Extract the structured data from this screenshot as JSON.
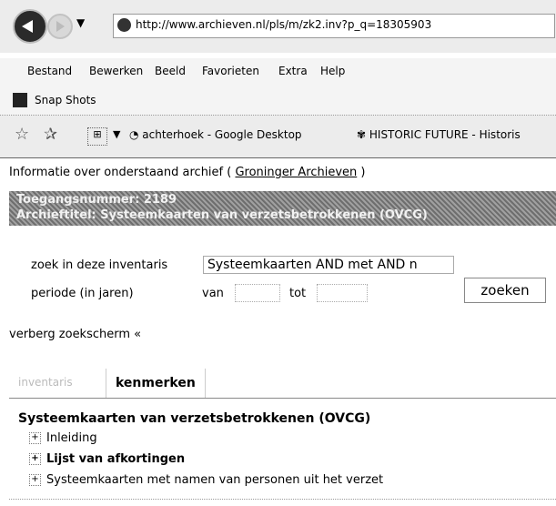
{
  "browser": {
    "url": "http://www.archieven.nl/pls/m/zk2.inv?p_q=18305903",
    "menu": [
      "Bestand",
      "Bewerken",
      "Beeld",
      "Favorieten",
      "Extra",
      "Help"
    ],
    "snapshots_label": "Snap Shots",
    "bookmarks": [
      "achterhoek - Google Desktop",
      "HISTORIC FUTURE - Historis"
    ]
  },
  "page": {
    "archive_info_prefix": "Informatie over onderstaand archief ( ",
    "archive_link": "Groninger Archieven",
    "archive_info_suffix": " )",
    "banner_line1": "Toegangsnummer: 2189",
    "banner_line2": "Archieftitel: Systeemkaarten van verzetsbetrokkenen (OVCG)",
    "search": {
      "label": "zoek in deze inventaris",
      "value": "Systeemkaarten AND met AND n",
      "period_label": "periode (in jaren)",
      "from_label": "van",
      "to_label": "tot",
      "button": "zoeken"
    },
    "hide_search": "verberg zoekscherm «",
    "tabs": [
      "inventaris",
      "kenmerken"
    ],
    "doc_title": "Systeemkaarten van verzetsbetrokkenen (OVCG)",
    "tree_items": [
      "Inleiding",
      "Lijst van afkortingen",
      "Systeemkaarten met namen van personen uit het verzet"
    ]
  }
}
